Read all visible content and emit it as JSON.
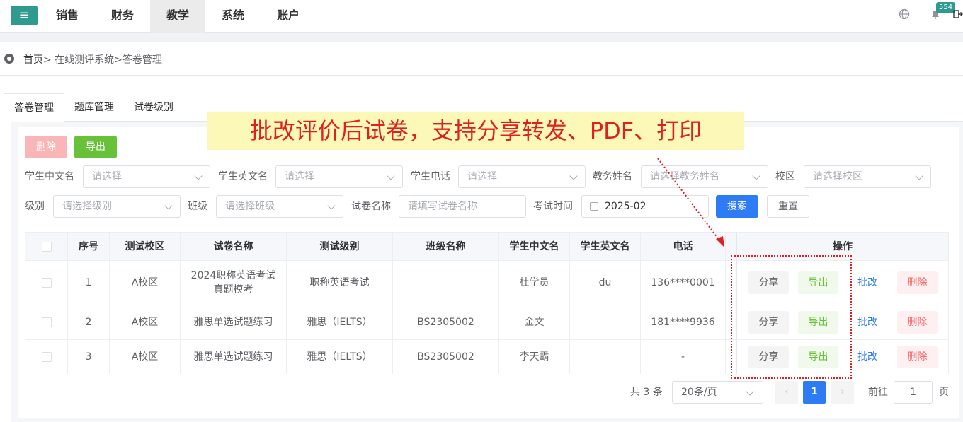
{
  "nav": {
    "menu_icon": "hamburger-icon",
    "items": [
      "销售",
      "财务",
      "教学",
      "系统",
      "账户"
    ],
    "active": "教学",
    "notification_count": "554"
  },
  "breadcrumb": {
    "home": "首页",
    "path": "> 在线测评系统>答卷管理"
  },
  "tabs": [
    "答卷管理",
    "题库管理",
    "试卷级别"
  ],
  "toolbar": {
    "delete_label": "删除",
    "export_label": "导出"
  },
  "banner": "批改评价后试卷，支持分享转发、PDF、打印",
  "filters": {
    "student_cn": {
      "label": "学生中文名",
      "placeholder": "请选择"
    },
    "student_en": {
      "label": "学生英文名",
      "placeholder": "请选择"
    },
    "student_phone": {
      "label": "学生电话",
      "placeholder": "请选择"
    },
    "staff_name": {
      "label": "教务姓名",
      "placeholder": "请选择教务姓名"
    },
    "campus": {
      "label": "校区",
      "placeholder": "请选择校区"
    },
    "level": {
      "label": "级别",
      "placeholder": "请选择级别"
    },
    "class": {
      "label": "班级",
      "placeholder": "请选择班级"
    },
    "paper_name": {
      "label": "试卷名称",
      "placeholder": "请填写试卷名称"
    },
    "exam_time": {
      "label": "考试时间",
      "value": "2025-02"
    },
    "search_label": "搜索",
    "reset_label": "重置"
  },
  "table": {
    "headers": [
      "序号",
      "测试校区",
      "试卷名称",
      "测试级别",
      "班级名称",
      "学生中文名",
      "学生英文名",
      "电话",
      "操作"
    ],
    "rows": [
      {
        "no": "1",
        "campus": "A校区",
        "paper": "2024职称英语考试真题模考",
        "level": "职称英语考试",
        "class": "",
        "name_cn": "杜学员",
        "name_en": "du",
        "phone": "136****0001"
      },
      {
        "no": "2",
        "campus": "A校区",
        "paper": "雅思单选试题练习",
        "level": "雅思（IELTS）",
        "class": "BS2305002",
        "name_cn": "金文",
        "name_en": "",
        "phone": "181****9936"
      },
      {
        "no": "3",
        "campus": "A校区",
        "paper": "雅思单选试题练习",
        "level": "雅思（IELTS）",
        "class": "BS2305002",
        "name_cn": "李天霸",
        "name_en": "",
        "phone": "-"
      }
    ],
    "actions": {
      "share": "分享",
      "export": "导出",
      "grade": "批改",
      "delete": "删除"
    }
  },
  "pagination": {
    "total": "共 3 条",
    "page_size": "20条/页",
    "current_page": "1",
    "goto_label": "前往",
    "goto_value": "1",
    "page_suffix": "页"
  },
  "colors": {
    "primary": "#2d7cf6",
    "success": "#67c23a",
    "danger": "#f56c6c",
    "brand": "#2e9b8e",
    "annotation": "#e02020"
  }
}
